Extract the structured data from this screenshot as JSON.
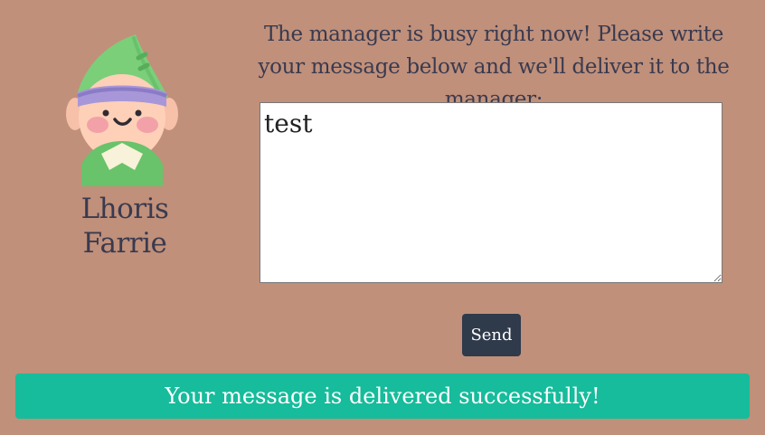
{
  "agent": {
    "name": "Lhoris Farrie",
    "avatar_icon": "elf-avatar-icon"
  },
  "prompt": {
    "text": "The manager is busy right now! Please write your message below and we'll deliver it to the manager:"
  },
  "message": {
    "value": "test"
  },
  "actions": {
    "send_label": "Send"
  },
  "status": {
    "success_message": "Your message is delivered successfully!"
  },
  "colors": {
    "background": "#c0907a",
    "send_button": "#2f3a4b",
    "success_banner": "#16bc9b"
  }
}
